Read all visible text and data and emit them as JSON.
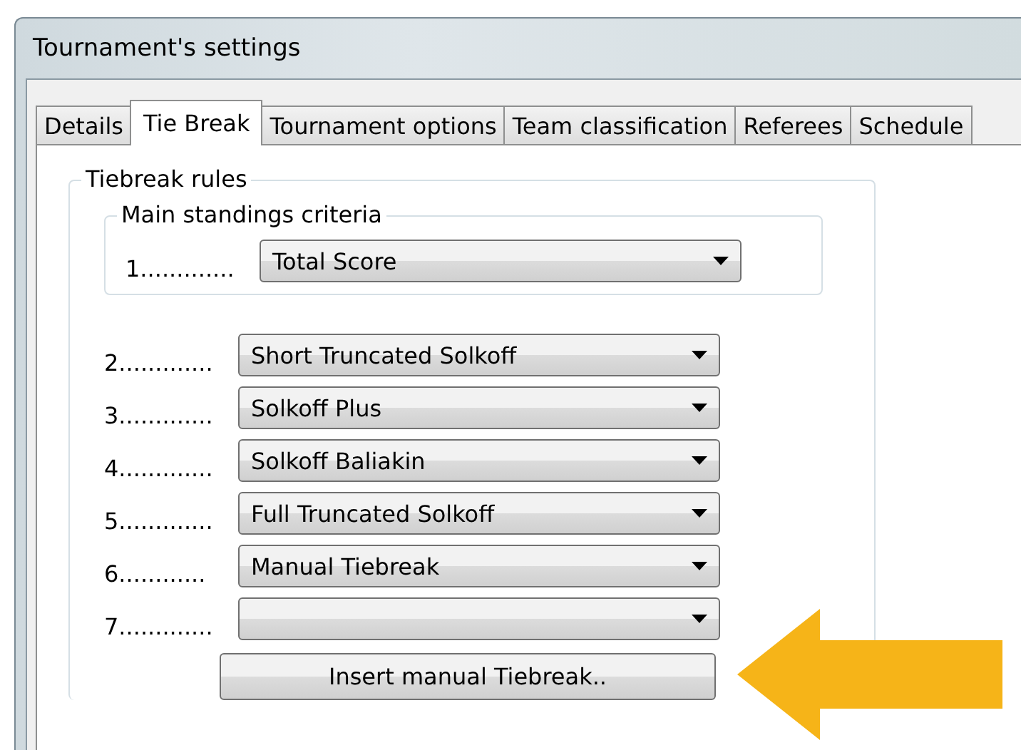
{
  "window": {
    "title": "Tournament's settings"
  },
  "tabs": [
    {
      "label": "Details",
      "selected": false
    },
    {
      "label": "Tie Break",
      "selected": true
    },
    {
      "label": "Tournament options",
      "selected": false
    },
    {
      "label": "Team classification",
      "selected": false
    },
    {
      "label": "Referees",
      "selected": false
    },
    {
      "label": "Schedule",
      "selected": false
    }
  ],
  "tiebreak_rules": {
    "title": "Tiebreak rules",
    "main_standings": {
      "title": "Main standings criteria",
      "rows": [
        {
          "label": "1.............",
          "value": "Total Score"
        }
      ]
    },
    "rows": [
      {
        "label": "2.............",
        "value": "Short Truncated Solkoff"
      },
      {
        "label": "3.............",
        "value": "Solkoff Plus"
      },
      {
        "label": "4.............",
        "value": "Solkoff Baliakin"
      },
      {
        "label": "5.............",
        "value": "Full Truncated Solkoff"
      },
      {
        "label": "6............",
        "value": "Manual Tiebreak"
      },
      {
        "label": "7............."
      }
    ],
    "button": "Insert manual Tiebreak.."
  }
}
